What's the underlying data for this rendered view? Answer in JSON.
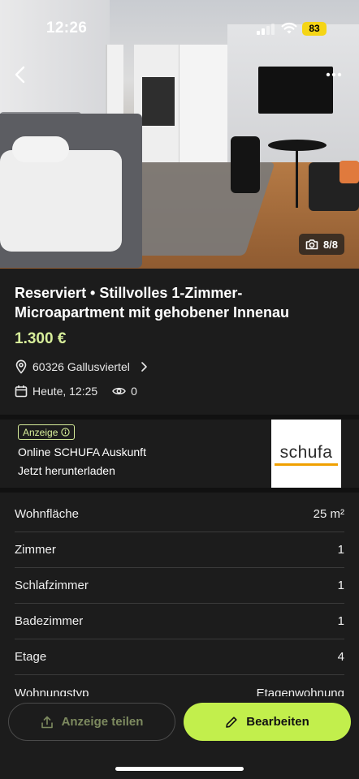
{
  "status_bar": {
    "time": "12:26",
    "battery": "83"
  },
  "photo": {
    "counter": "8/8"
  },
  "listing": {
    "title": "Reserviert • Stillvolles 1-Zimmer-Microapartment mit gehobener Innenau",
    "price": "1.300 €",
    "location": "60326 Gallusviertel",
    "date": "Heute, 12:25",
    "views": "0"
  },
  "ad": {
    "badge": "Anzeige",
    "title": "Online SCHUFA Auskunft",
    "subtitle": "Jetzt herunterladen",
    "logo_text": "schufa"
  },
  "details": [
    {
      "label": "Wohnfläche",
      "value": "25 m²"
    },
    {
      "label": "Zimmer",
      "value": "1"
    },
    {
      "label": "Schlafzimmer",
      "value": "1"
    },
    {
      "label": "Badezimmer",
      "value": "1"
    },
    {
      "label": "Etage",
      "value": "4"
    },
    {
      "label": "Wohnungstyp",
      "value": "Etagenwohnung"
    }
  ],
  "actions": {
    "share_label": "Anzeige teilen",
    "edit_label": "Bearbeiten"
  },
  "colors": {
    "accent": "#c2ef4c",
    "price": "#d7ee9a",
    "background": "#1c1c1c"
  }
}
